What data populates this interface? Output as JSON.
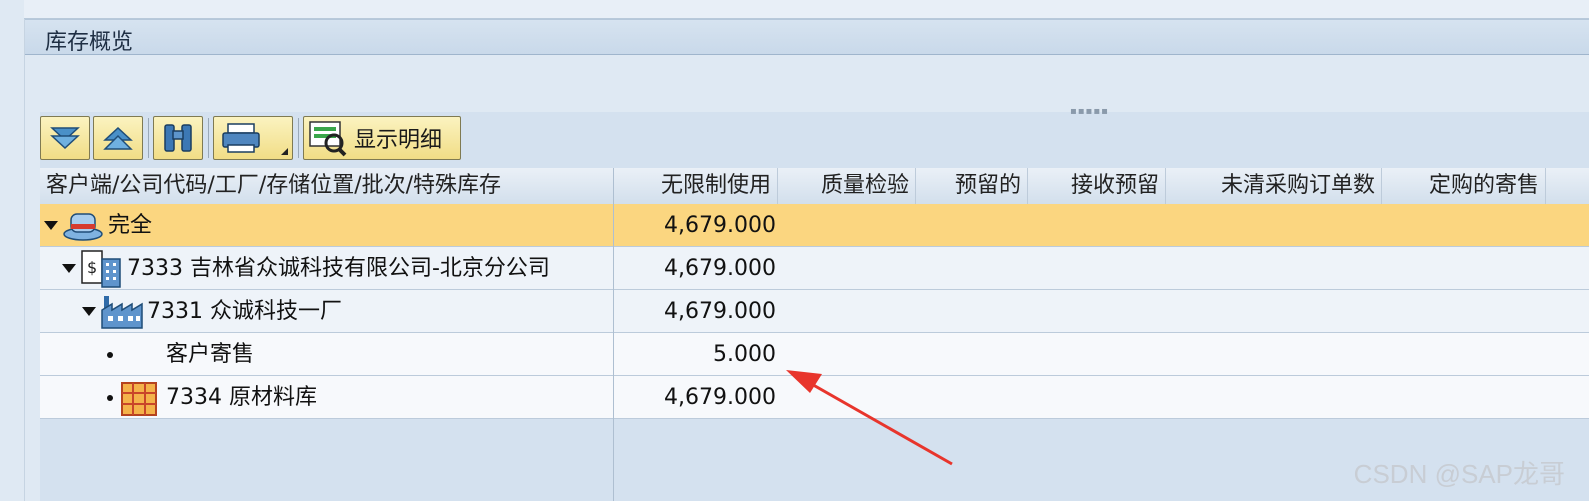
{
  "panel": {
    "title": "库存概览"
  },
  "toolbar": {
    "expand_all_label": "",
    "collapse_all_label": "",
    "find_label": "",
    "print_label": "",
    "show_detail_label": "显示明细"
  },
  "grid": {
    "columns": [
      "客户端/公司代码/工厂/存储位置/批次/特殊库存",
      "无限制使用",
      "质量检验",
      "预留的",
      "接收预留",
      "未清采购订单数",
      "定购的寄售"
    ],
    "rows": [
      {
        "label": "完全",
        "unrestricted": "4,679.000",
        "icon": "stock-total-icon",
        "expanded": true,
        "highlighted": true
      },
      {
        "label": "7333 吉林省众诚科技有限公司-北京分公司",
        "unrestricted": "4,679.000",
        "icon": "company-building-icon",
        "expanded": true
      },
      {
        "label": "7331 众诚科技一厂",
        "unrestricted": "4,679.000",
        "icon": "factory-icon",
        "expanded": true
      },
      {
        "label": "客户寄售",
        "unrestricted": "5.000",
        "icon": "",
        "expanded": false
      },
      {
        "label": "7334 原材料库",
        "unrestricted": "4,679.000",
        "icon": "storage-shelf-icon",
        "expanded": false
      }
    ]
  },
  "annotation": {
    "arrow_color": "#e8352c"
  },
  "watermark": "CSDN @SAP龙哥"
}
